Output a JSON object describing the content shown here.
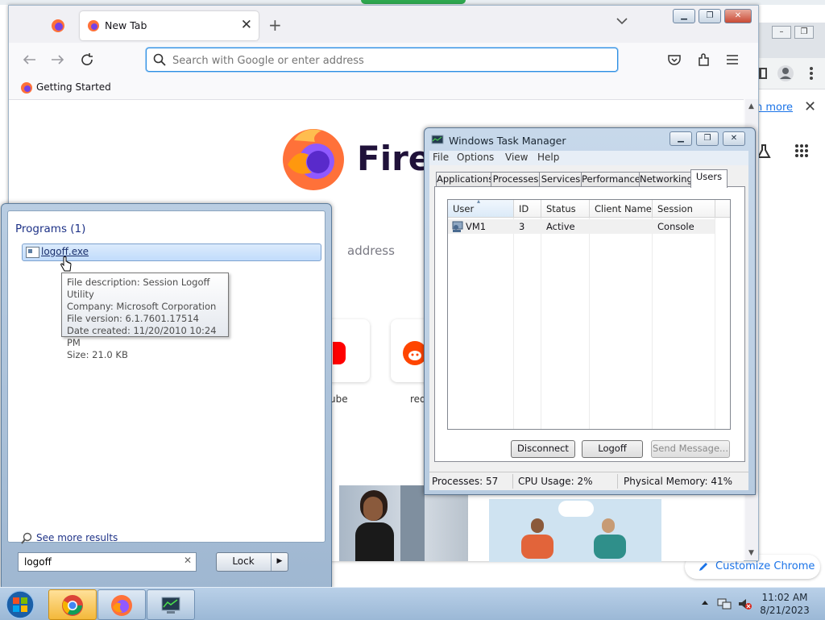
{
  "chrome": {
    "learn_more": "n more",
    "customize": "Customize Chrome"
  },
  "firefox": {
    "tab_title": "New Tab",
    "url_placeholder": "Search with Google or enter address",
    "bookmark": "Getting Started",
    "wordmark": "Firef",
    "search_hint": "address",
    "shortcuts": [
      {
        "label": "ube",
        "color": "#ff0000"
      },
      {
        "label": "red",
        "color": "#ff4500"
      }
    ]
  },
  "startmenu": {
    "heading": "Programs (1)",
    "result": "logoff.exe",
    "tooltip": [
      "File description: Session Logoff Utility",
      "Company: Microsoft Corporation",
      "File version: 6.1.7601.17514",
      "Date created: 11/20/2010 10:24 PM",
      "Size: 21.0 KB"
    ],
    "see_more": "See more results",
    "search_value": "logoff",
    "lock_label": "Lock"
  },
  "taskmgr": {
    "title": "Windows Task Manager",
    "menu": [
      "File",
      "Options",
      "View",
      "Help"
    ],
    "tabs": [
      "Applications",
      "Processes",
      "Services",
      "Performance",
      "Networking",
      "Users"
    ],
    "active_tab": "Users",
    "columns": [
      "User",
      "ID",
      "Status",
      "Client Name",
      "Session"
    ],
    "rows": [
      {
        "user": "VM1",
        "id": "3",
        "status": "Active",
        "client": "",
        "session": "Console"
      }
    ],
    "buttons": {
      "disconnect": "Disconnect",
      "logoff": "Logoff",
      "send": "Send Message..."
    },
    "status": {
      "processes": "Processes: 57",
      "cpu": "CPU Usage: 2%",
      "memory": "Physical Memory: 41%"
    }
  },
  "taskbar": {
    "time": "11:02 AM",
    "date": "8/21/2023"
  }
}
